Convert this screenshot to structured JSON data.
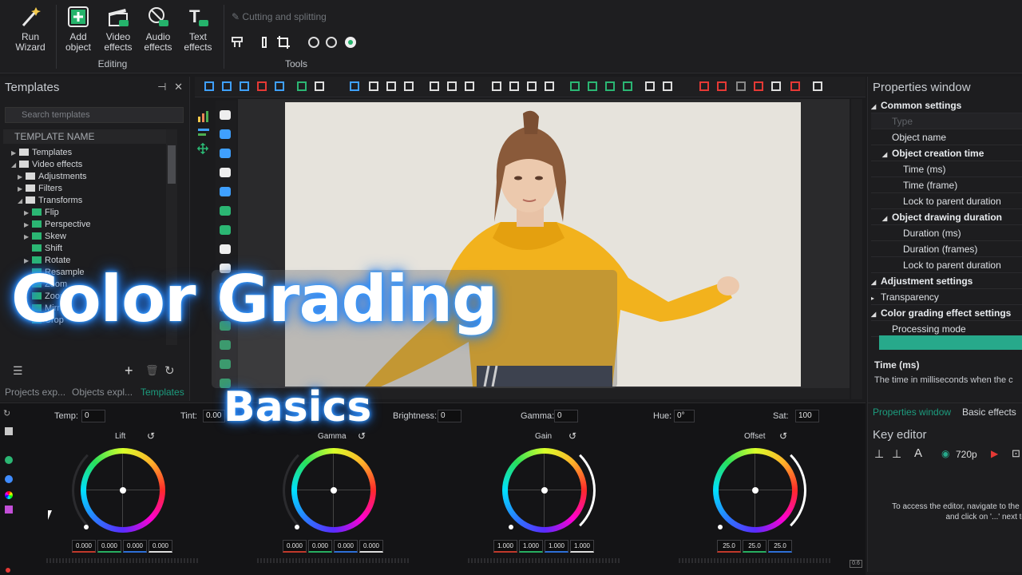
{
  "ribbon": {
    "run_wizard": "Run\nWizard",
    "add_object": "Add\nobject",
    "video_effects": "Video\neffects",
    "audio_effects": "Audio\neffects",
    "text_effects": "Text\neffects",
    "editing_caption": "Editing",
    "cutting_label": "Cutting and splitting",
    "tools_caption": "Tools"
  },
  "templates_panel": {
    "title": "Templates",
    "search_placeholder": "Search templates",
    "column_header": "TEMPLATE NAME",
    "tree": [
      {
        "label": "Templates",
        "level": 1,
        "arrow": "▶"
      },
      {
        "label": "Video effects",
        "level": 1,
        "arrow": "◢"
      },
      {
        "label": "Adjustments",
        "level": 2,
        "arrow": "▶"
      },
      {
        "label": "Filters",
        "level": 2,
        "arrow": "▶"
      },
      {
        "label": "Transforms",
        "level": 2,
        "arrow": "◢"
      },
      {
        "label": "Flip",
        "level": 3,
        "arrow": "▶"
      },
      {
        "label": "Perspective",
        "level": 3,
        "arrow": "▶"
      },
      {
        "label": "Skew",
        "level": 3,
        "arrow": "▶"
      },
      {
        "label": "Shift",
        "level": 3,
        "arrow": ""
      },
      {
        "label": "Rotate",
        "level": 3,
        "arrow": "▶"
      },
      {
        "label": "Resample",
        "level": 3,
        "arrow": ""
      },
      {
        "label": "Zoom",
        "level": 3,
        "arrow": ""
      },
      {
        "label": "Zoom",
        "level": 3,
        "arrow": ""
      },
      {
        "label": "Mirror",
        "level": 3,
        "arrow": ""
      },
      {
        "label": "Crop",
        "level": 3,
        "arrow": ""
      }
    ],
    "tabs": [
      "Projects exp...",
      "Objects expl...",
      "Templates"
    ]
  },
  "properties": {
    "title": "Properties window",
    "rows": [
      {
        "label": "Common settings",
        "type": "group",
        "indent": 0
      },
      {
        "label": "Type",
        "type": "disabled",
        "indent": 1
      },
      {
        "label": "Object name",
        "type": "item",
        "indent": 1
      },
      {
        "label": "Object creation time",
        "type": "group",
        "indent": 1
      },
      {
        "label": "Time (ms)",
        "type": "item",
        "indent": 2
      },
      {
        "label": "Time (frame)",
        "type": "item",
        "indent": 2
      },
      {
        "label": "Lock to parent duration",
        "type": "item",
        "indent": 2
      },
      {
        "label": "Object drawing duration",
        "type": "group",
        "indent": 1
      },
      {
        "label": "Duration (ms)",
        "type": "item",
        "indent": 2
      },
      {
        "label": "Duration (frames)",
        "type": "item",
        "indent": 2
      },
      {
        "label": "Lock to parent duration",
        "type": "item",
        "indent": 2
      },
      {
        "label": "Adjustment settings",
        "type": "group",
        "indent": 0
      },
      {
        "label": "Transparency",
        "type": "collapsed",
        "indent": 0
      },
      {
        "label": "Color grading effect settings",
        "type": "group",
        "indent": 0
      },
      {
        "label": "Processing mode",
        "type": "item",
        "indent": 1
      }
    ],
    "desc_title": "Time (ms)",
    "desc_text": "The time in milliseconds when the c",
    "tabs": [
      "Properties window",
      "Basic effects"
    ],
    "accent": "#27a98b"
  },
  "key_editor": {
    "title": "Key editor",
    "resolution": "720p",
    "message_line1": "To access the editor, navigate to the p",
    "message_line2": "and click on '...' next to"
  },
  "grading": {
    "fields": [
      {
        "label": "Temp:",
        "value": "0"
      },
      {
        "label": "Tint:",
        "value": "0.00"
      },
      {
        "label": "Brightness:",
        "value": "0"
      },
      {
        "label": "Gamma:",
        "value": "0"
      },
      {
        "label": "Hue:",
        "value": "0°"
      },
      {
        "label": "Sat:",
        "value": "100"
      }
    ],
    "wheels": [
      {
        "label": "Lift",
        "values": [
          "0.000",
          "0.000",
          "0.000",
          "0.000"
        ]
      },
      {
        "label": "Gamma",
        "values": [
          "0.000",
          "0.000",
          "0.000",
          "0.000"
        ]
      },
      {
        "label": "Gain",
        "values": [
          "1.000",
          "1.000",
          "1.000",
          "1.000"
        ]
      },
      {
        "label": "Offset",
        "values": [
          "25.0",
          "25.0",
          "25.0"
        ]
      }
    ]
  },
  "overlay": {
    "title": "Color Grading",
    "subtitle": "Basics"
  }
}
